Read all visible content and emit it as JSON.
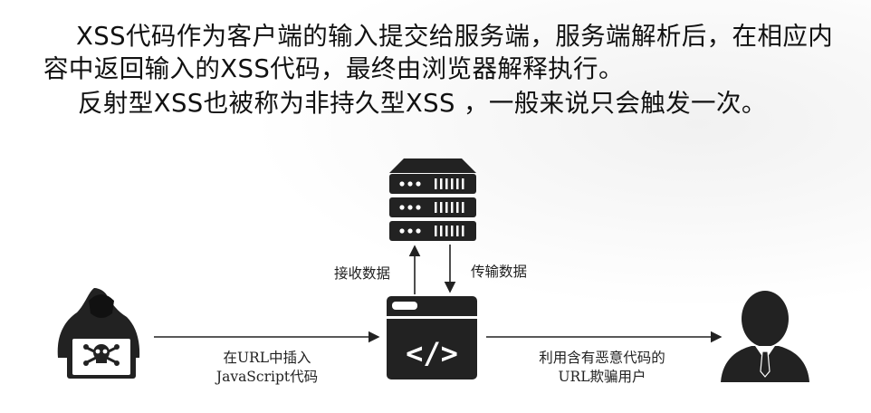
{
  "text": {
    "paragraph1": "XSS代码作为客户端的输入提交给服务端，服务端解析后，在相应内容中返回输入的XSS代码，最终由浏览器解释执行。",
    "paragraph2": "反射型XSS也被称为非持久型XSS ，一般来说只会触发一次。"
  },
  "diagram": {
    "receive_label": "接收数据",
    "transmit_label": "传输数据",
    "attacker_label_line1": "在URL中插入",
    "attacker_label_line2": "JavaScript代码",
    "victim_label_line1": "利用含有恶意代码的",
    "victim_label_line2": "URL欺骗用户",
    "code_symbol": "</>"
  }
}
